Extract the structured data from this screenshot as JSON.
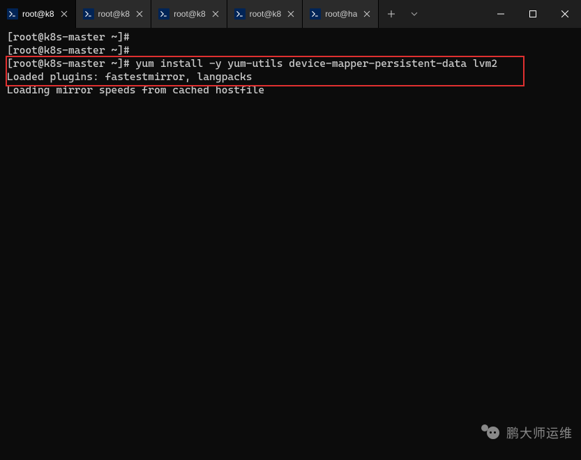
{
  "tabs": [
    {
      "label": "root@k8",
      "active": true
    },
    {
      "label": "root@k8",
      "active": false
    },
    {
      "label": "root@k8",
      "active": false
    },
    {
      "label": "root@k8",
      "active": false
    },
    {
      "label": "root@ha",
      "active": false
    }
  ],
  "terminal": {
    "lines": [
      "[root@k8s-master ~]#",
      "[root@k8s-master ~]#",
      "[root@k8s-master ~]# yum install -y yum-utils device-mapper-persistent-data lvm2",
      "Loaded plugins: fastestmirror, langpacks",
      "Loading mirror speeds from cached hostfile"
    ]
  },
  "watermark": {
    "text": "鹏大师运维"
  }
}
